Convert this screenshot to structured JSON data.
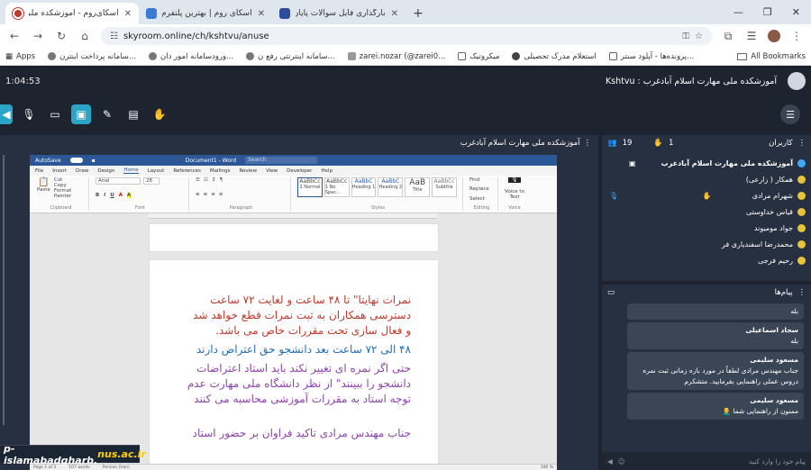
{
  "tabs": [
    {
      "title": "اسکای‌روم - آموزشکده ملی مه"
    },
    {
      "title": "اسکای روم | بهترین پلتفرم برگزاری"
    },
    {
      "title": "بارگذاری فایل سوالات پایان نیمسا"
    }
  ],
  "new_tab": "+",
  "address": {
    "url": "skyroom.online/ch/kshtvu/anuse"
  },
  "bookmarks": {
    "apps": "Apps",
    "items": [
      "سامانه پرداخت اینترن...",
      "ورودسامانه امور دان...",
      "سامانه اینترنتی رفع ن...",
      "zarei.nozar (@zarei0...",
      "میکروتیک",
      "استعلام مدرک تحصیلی",
      "پرونده‌ها - آپلود سنتر..."
    ],
    "all": "All Bookmarks"
  },
  "header": {
    "timer": "1:04:53",
    "room_title": "Kshtvu : آموزشکده ملی مهارت اسلام آبادغرب"
  },
  "share_panel": {
    "title": "آموزشکده ملی مهارت اسلام آبادغرب"
  },
  "word": {
    "title_bar": "Document1 - Word",
    "search": "Search",
    "autosave": "AutoSave",
    "tabs": [
      "File",
      "Insert",
      "Draw",
      "Design",
      "Home",
      "Layout",
      "References",
      "Mailings",
      "Review",
      "View",
      "Developer",
      "Help"
    ],
    "groups": [
      "Clipboard",
      "Font",
      "Paragraph",
      "Styles",
      "Editing",
      "Voice"
    ],
    "styles": [
      "1 Normal",
      "1 No Spac...",
      "Heading 1",
      "Heading 2",
      "Title",
      "Subtitle"
    ],
    "editing": [
      "Find",
      "Replace",
      "Select"
    ],
    "voice": "Voice to Text",
    "font_name": "Arial",
    "font_size": "28",
    "paste": "Paste",
    "cut": "Cut",
    "copy": "Copy",
    "format_painter": "Format Painter",
    "status": [
      "Page 1 of 3",
      "107 words",
      "Persian (Iran)"
    ],
    "zoom": "100 %",
    "lines": [
      {
        "text": "نمرات نهایتا\" تا ۴۸ ساعت و لغایت ۷۲ ساعت",
        "color": "red"
      },
      {
        "text": "دسترسی همکاران به ثبت نمرات قطع خواهد شد",
        "color": "red"
      },
      {
        "text": "و فعال سازی تحت مقررات خاص می باشد.",
        "color": "red"
      },
      {
        "text": "۴۸ الی ۷۲ ساعت بعد دانشجو حق اعتراض دارند",
        "color": "blue"
      },
      {
        "text": "حتی اگر نمره ای تغییر نکند باید استاد اعتراضات",
        "color": "purple"
      },
      {
        "text": "دانشجو را ببینند\" از نظر دانشگاه ملی مهارت عدم",
        "color": "purple"
      },
      {
        "text": "توجه استاد به مقررات آموزشی محاسبه می کنند",
        "color": "purple"
      },
      {
        "text": "",
        "color": "purple"
      },
      {
        "text": "جناب مهندس مرادی تاکید فراوان بر حضور استاد",
        "color": "purple"
      }
    ]
  },
  "watermark": {
    "prefix": "p-islamabadgharb.",
    "highlight": "nus.ac.ir"
  },
  "users_panel": {
    "title": "کاربران",
    "raised_count": "1",
    "user_count": "19",
    "users": [
      {
        "name": "آموزشکده ملی مهارت اسلام آبادغرب",
        "bold": true
      },
      {
        "name": "همکار ( زارعی)"
      },
      {
        "name": "شهرام مرادی"
      },
      {
        "name": "قیاس خداوستی"
      },
      {
        "name": "جواد مومیوند"
      },
      {
        "name": "محمدرضا اسفندیاری فر"
      },
      {
        "name": "رحیم فرجی"
      }
    ]
  },
  "chat": {
    "title": "پیام‌ها",
    "messages": [
      {
        "sender": "",
        "text": "بله"
      },
      {
        "sender": "سجاد اسماعیلی",
        "text": "بله"
      },
      {
        "sender": "مسعود سلیمی",
        "text": "جناب مهندس مرادی لطفاً در مورد بازه زمانی ثبت نمره دروس عملی راهنمایی بفرمایید. متشکرم"
      },
      {
        "sender": "مسعود سلیمی",
        "text": "ممنون از راهنمایی شما 👨‍🦲"
      }
    ],
    "input_placeholder": "پیام خود را وارد کنید"
  }
}
